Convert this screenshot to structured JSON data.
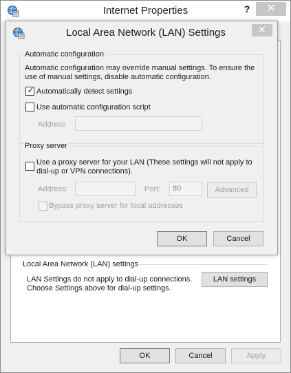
{
  "outer": {
    "title": "Internet Properties",
    "help_glyph": "?",
    "close_glyph": "✕",
    "lan_section_header": "Local Area Network (LAN) settings",
    "lan_note_line1": "LAN Settings do not apply to dial-up connections.",
    "lan_note_line2": "Choose Settings above for dial-up settings.",
    "lan_settings_button": "LAN settings",
    "ok_label": "OK",
    "cancel_label": "Cancel",
    "apply_label": "Apply"
  },
  "dialog": {
    "title": "Local Area Network (LAN) Settings",
    "close_glyph": "✕",
    "auto_config": {
      "legend": "Automatic configuration",
      "description_line1": "Automatic configuration may override manual settings.  To ensure the",
      "description_line2": "use of manual settings, disable automatic configuration.",
      "auto_detect_label": "Automatically detect settings",
      "auto_detect_checked": true,
      "use_script_label": "Use automatic configuration script",
      "use_script_checked": false,
      "address_label": "Address",
      "address_value": ""
    },
    "proxy": {
      "legend": "Proxy server",
      "use_proxy_label_line1": "Use a proxy server for your LAN (These settings will not apply to",
      "use_proxy_label_line2": "dial-up or VPN connections).",
      "use_proxy_checked": false,
      "address_label": "Address:",
      "address_value": "",
      "port_label": "Port:",
      "port_value": "80",
      "advanced_label": "Advanced",
      "bypass_label": "Bypass proxy server for local addresses",
      "bypass_checked": false
    },
    "ok_label": "OK",
    "cancel_label": "Cancel"
  },
  "icons": {
    "app_icon": "globe-settings-icon",
    "check_mark": "✓"
  }
}
